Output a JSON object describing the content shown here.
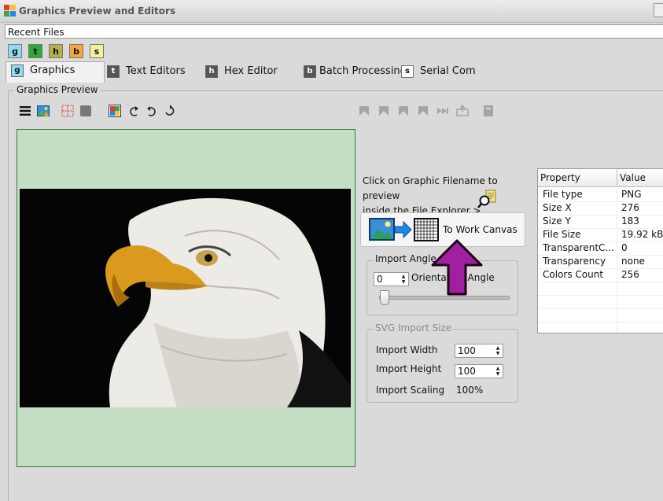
{
  "window": {
    "title": "Graphics Preview and Editors"
  },
  "recent_files": {
    "label": "Recent Files"
  },
  "quick_tabs": [
    {
      "letter": "g",
      "color": "#8fdcf2"
    },
    {
      "letter": "t",
      "color": "#2fa83a"
    },
    {
      "letter": "h",
      "color": "#b7b04a"
    },
    {
      "letter": "b",
      "color": "#f3a73b"
    },
    {
      "letter": "s",
      "color": "#f2f29a"
    }
  ],
  "tabs": [
    {
      "letter": "g",
      "label": "Graphics",
      "active": true
    },
    {
      "letter": "t",
      "label": "Text Editors"
    },
    {
      "letter": "h",
      "label": "Hex Editor"
    },
    {
      "letter": "b",
      "label": "Batch Processing"
    },
    {
      "letter": "s",
      "label": "Serial Com"
    }
  ],
  "panel": {
    "title": "Graphics Preview"
  },
  "toolbar_left": [
    "hamburger-menu-icon",
    "image-load-icon",
    "grid-select-icon",
    "square-icon",
    "color-picker-icon",
    "rotate-left-icon",
    "rotate-right-icon",
    "rotate-icon"
  ],
  "toolbar_right": [
    "first-frame-icon",
    "prev-frame-icon",
    "next-frame-icon",
    "last-frame-icon",
    "play-icon",
    "export-icon",
    "close-document-icon"
  ],
  "hint": {
    "line1": "Click on Graphic Filename to preview",
    "line2": "inside the File Explorer >"
  },
  "to_work_canvas": {
    "label": "To Work Canvas"
  },
  "import_angle": {
    "title": "Import Angle",
    "value": "0",
    "orientation_label": "Orientation Angle",
    "slider": 0
  },
  "svg_import": {
    "title": "SVG Import Size",
    "width_label": "Import Width",
    "width_value": "100",
    "height_label": "Import Height",
    "height_value": "100",
    "scaling_label": "Import Scaling",
    "scaling_value": "100%"
  },
  "properties": {
    "headers": [
      "Property",
      "Value"
    ],
    "rows": [
      [
        "File type",
        "PNG"
      ],
      [
        "Size X",
        "276"
      ],
      [
        "Size Y",
        "183"
      ],
      [
        "File Size",
        "19.92 kB"
      ],
      [
        "TransparentC...",
        "0"
      ],
      [
        "Transparency",
        "none"
      ],
      [
        "Colors Count",
        "256"
      ]
    ]
  },
  "colors": {
    "preview_bg": "#c3dec4",
    "preview_border": "#2e7d32",
    "arrow": "#a020a0"
  }
}
